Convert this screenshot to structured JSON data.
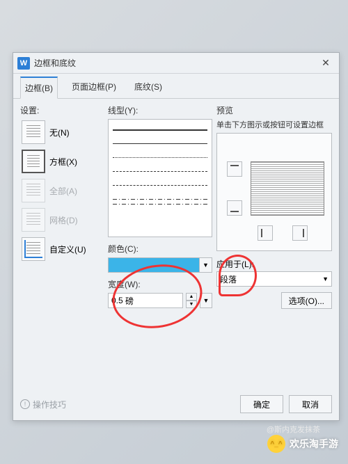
{
  "dialog": {
    "title": "边框和底纹",
    "icon_glyph": "W"
  },
  "tabs": [
    {
      "label": "边框(B)",
      "active": true
    },
    {
      "label": "页面边框(P)",
      "active": false
    },
    {
      "label": "底纹(S)",
      "active": false
    }
  ],
  "settings": {
    "label": "设置:",
    "items": [
      {
        "key": "none",
        "label": "无(N)",
        "selected": false,
        "disabled": false
      },
      {
        "key": "box",
        "label": "方框(X)",
        "selected": true,
        "disabled": false
      },
      {
        "key": "all",
        "label": "全部(A)",
        "selected": false,
        "disabled": true
      },
      {
        "key": "grid",
        "label": "网格(D)",
        "selected": false,
        "disabled": true
      },
      {
        "key": "custom",
        "label": "自定义(U)",
        "selected": false,
        "disabled": false
      }
    ]
  },
  "line_style": {
    "label": "线型(Y):"
  },
  "color": {
    "label": "颜色(C):",
    "value_hex": "#3bb4e8"
  },
  "width": {
    "label": "宽度(W):",
    "value": "0.5",
    "unit": "磅"
  },
  "preview": {
    "label": "预览",
    "desc": "单击下方图示或按钮可设置边框"
  },
  "apply": {
    "label": "应用于(L):",
    "value": "段落"
  },
  "buttons": {
    "options": "选项(O)...",
    "ok": "确定",
    "cancel": "取消"
  },
  "tips": {
    "label": "操作技巧"
  },
  "watermark": {
    "text": "欢乐淘手游"
  },
  "attribution": "@斯内克发抹茶"
}
